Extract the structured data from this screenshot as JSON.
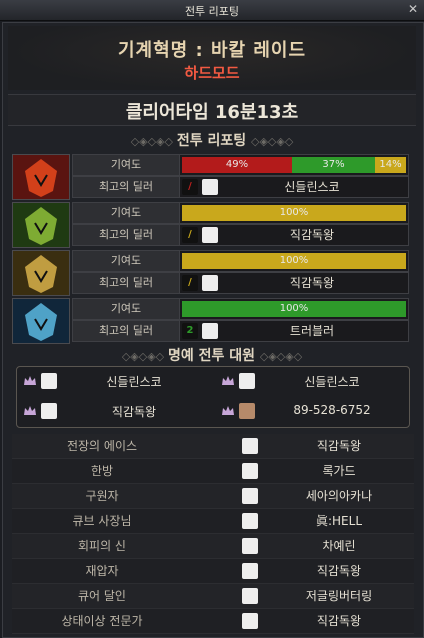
{
  "window": {
    "title": "전투 리포팅",
    "close_glyph": "✕"
  },
  "header": {
    "dungeon": "기계혁명 : 바칼 레이드",
    "mode": "하드모드"
  },
  "clear_time": "클리어타임 16분13초",
  "section_report": "전투 리포팅",
  "section_honor": "명예 전투 대원",
  "labels": {
    "contribution": "기여도",
    "best_dealer": "최고의 딜러"
  },
  "parties": [
    {
      "portrait": "red-dragon-portrait-icon",
      "bars": [
        {
          "label": "49%",
          "value": 49,
          "color": "#b31b1b"
        },
        {
          "label": "37%",
          "value": 37,
          "color": "#2e9a2a"
        },
        {
          "label": "14%",
          "value": 14,
          "color": "#c9a81c"
        }
      ],
      "weapon_glyph": "/",
      "weapon_color": "#c0201e",
      "dealer": "신들린스코"
    },
    {
      "portrait": "green-dragon-portrait-icon",
      "bars": [
        {
          "label": "100%",
          "value": 100,
          "color": "#c9a81c"
        }
      ],
      "weapon_glyph": "/",
      "weapon_color": "#c9a81c",
      "dealer": "직감독왕"
    },
    {
      "portrait": "gold-dragon-portrait-icon",
      "bars": [
        {
          "label": "100%",
          "value": 100,
          "color": "#c9a81c"
        }
      ],
      "weapon_glyph": "/",
      "weapon_color": "#c9a81c",
      "dealer": "직감독왕"
    },
    {
      "portrait": "blue-dragon-portrait-icon",
      "bars": [
        {
          "label": "100%",
          "value": 100,
          "color": "#2e9a2a"
        }
      ],
      "weapon_glyph": "2",
      "weapon_color": "#2e9a2a",
      "dealer": "트러블러"
    }
  ],
  "honor_members": [
    "신들린스코",
    "신들린스코",
    "직감독왕",
    "89-528-6752"
  ],
  "awards": [
    {
      "title": "전장의 에이스",
      "name": "직감독왕"
    },
    {
      "title": "한방",
      "name": "록가드"
    },
    {
      "title": "구원자",
      "name": "세아의아카나"
    },
    {
      "title": "큐브 사장님",
      "name": "眞:HELL"
    },
    {
      "title": "회피의 신",
      "name": "차예린"
    },
    {
      "title": "재압자",
      "name": "직감독왕"
    },
    {
      "title": "큐어 달인",
      "name": "저글링버터링"
    },
    {
      "title": "상태이상 전문가",
      "name": "직감독왕"
    }
  ]
}
